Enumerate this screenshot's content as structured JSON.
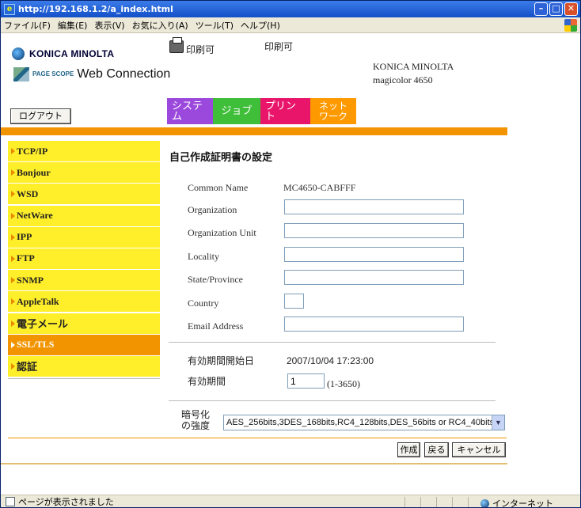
{
  "window": {
    "title": "http://192.168.1.2/a_index.html"
  },
  "menu": [
    "ファイル(F)",
    "編集(E)",
    "表示(V)",
    "お気に入り(A)",
    "ツール(T)",
    "ヘルプ(H)"
  ],
  "header": {
    "brand": "KONICA MINOLTA",
    "product_small": "PAGE SCOPE",
    "product": "Web Connection",
    "status_icon_label": "印刷可",
    "status_text": "印刷可",
    "model_line1": "KONICA MINOLTA",
    "model_line2": "magicolor 4650",
    "logout": "ログアウト"
  },
  "tabs": [
    {
      "label": "システム",
      "color": "#9b49dc"
    },
    {
      "label": "ジョブ",
      "color": "#3fbe3a"
    },
    {
      "label": "プリント",
      "color": "#e8156a"
    },
    {
      "label": "ネットワーク",
      "color": "#fe9a00"
    }
  ],
  "sidebar": {
    "items": [
      {
        "label": "TCP/IP"
      },
      {
        "label": "Bonjour"
      },
      {
        "label": "WSD"
      },
      {
        "label": "NetWare"
      },
      {
        "label": "IPP"
      },
      {
        "label": "FTP"
      },
      {
        "label": "SNMP"
      },
      {
        "label": "AppleTalk"
      },
      {
        "label": "電子メール"
      },
      {
        "label": "SSL/TLS",
        "active": true
      },
      {
        "label": "認証"
      }
    ]
  },
  "main": {
    "title": "自己作成証明書の設定",
    "common_name_label": "Common Name",
    "common_name_value": "MC4650-CABFFF",
    "organization_label": "Organization",
    "organization_value": "",
    "org_unit_label": "Organization Unit",
    "org_unit_value": "",
    "locality_label": "Locality",
    "locality_value": "",
    "state_label": "State/Province",
    "state_value": "",
    "country_label": "Country",
    "country_value": "",
    "email_label": "Email Address",
    "email_value": "",
    "valid_start_label": "有効期間開始日",
    "valid_start_value": "2007/10/04 17:23:00",
    "valid_period_label": "有効期間",
    "valid_period_value": "1",
    "valid_period_range": "(1-3650)",
    "encryption_label_1": "暗号化",
    "encryption_label_2": "の強度",
    "encryption_value": "AES_256bits,3DES_168bits,RC4_128bits,DES_56bits or RC4_40bits"
  },
  "buttons": {
    "create": "作成",
    "back": "戻る",
    "cancel": "キャンセル"
  },
  "statusbar": {
    "text": "ページが表示されました",
    "zone": "インターネット"
  }
}
